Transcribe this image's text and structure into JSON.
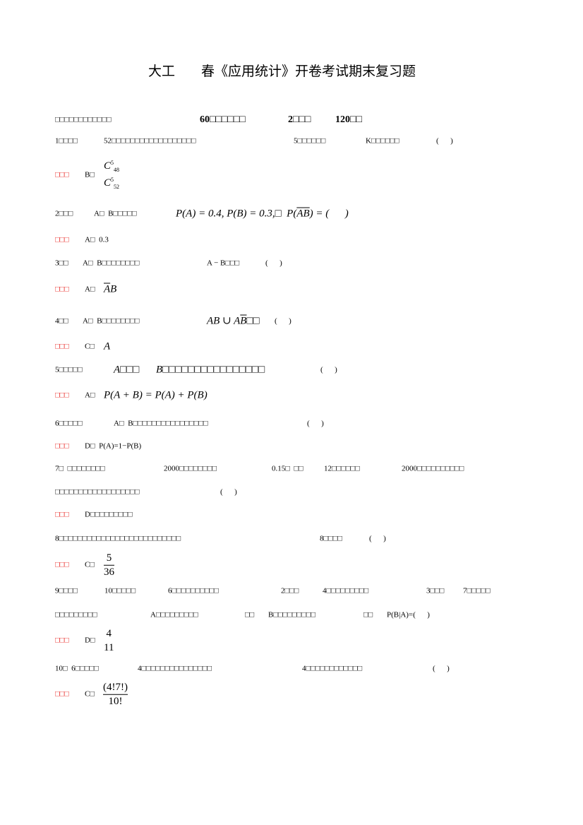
{
  "title": {
    "part1": "大工",
    "part2": "春《应用统计》开卷考试期末复习题"
  },
  "section": {
    "label": "□□□□□□□□□□□□",
    "count": "60□□□□□□",
    "points": "2□□□",
    "total": "120□□"
  },
  "answer_label": "□□□",
  "blank": "(      )",
  "q1": {
    "num": "1□□□□",
    "a": "52□□□□□□□□□□□□□□□□□□",
    "b": "5□□□□□□",
    "c": "K□□□□□□",
    "ans": "B□",
    "frac_num": "C",
    "frac_num_sup": "5",
    "frac_num_sub": "48",
    "frac_den": "C",
    "frac_den_sup": "5",
    "frac_den_sub": "52"
  },
  "q2": {
    "num": "2□□□",
    "a": "A□  B□□□□□",
    "formula": "P(A) = 0.4, P(B) = 0.3,□  P(",
    "formula_bar": "AB",
    "formula_end": ") = (      )",
    "ans": "A□  0.3"
  },
  "q3": {
    "num": "3□□",
    "a": "A□  B□□□□□□□□",
    "b": "A − B□□□",
    "ans": "A□",
    "ans_bar": "A",
    "ans_rest": "B"
  },
  "q4": {
    "num": "4□□",
    "a": "A□  B□□□□□□□□",
    "b1": "AB ∪ A",
    "b_bar": "B",
    "b2": "□□",
    "ans": "C□",
    "ans_math": "A"
  },
  "q5": {
    "num": "5□□□□□",
    "a": "A□□□",
    "b": "B□□□□□□□□□□□□□□□□",
    "ans": "A□",
    "ans_math": "P(A + B) = P(A) + P(B)"
  },
  "q6": {
    "num": "6□□□□□",
    "a": "A□  B□□□□□□□□□□□□□□□□",
    "ans": "D□  P(A)=1−P(B)"
  },
  "q7": {
    "num": "7□  □□□□□□□□",
    "a": "2000□□□□□□□□",
    "b": "0.15□  □□",
    "c": "12□□□□□□",
    "d": "2000□□□□□□□□□□",
    "line2": "□□□□□□□□□□□□□□□□□□",
    "ans": "D□□□□□□□□□"
  },
  "q8": {
    "num": "8□□□□□□□□□□□□□□□□□□□□□□□□□□",
    "a": "8□□□□",
    "ans": "C□",
    "frac_num": "5",
    "frac_den": "36"
  },
  "q9": {
    "num": "9□□□□",
    "a": "10□□□□□",
    "b": "6□□□□□□□□□□",
    "c": "2□□□",
    "d": "4□□□□□□□□□",
    "e": "3□□□",
    "f": "7□□□□□",
    "line2": "□□□□□□□□□",
    "g": "A□□□□□□□□□",
    "h": "□□",
    "i": "B□□□□□□□□□",
    "j": "□□",
    "k": "P(B|A)=(      )",
    "ans": "D□",
    "frac_num": "4",
    "frac_den": "11"
  },
  "q10": {
    "num": "10□  6□□□□□",
    "a": "4□□□□□□□□□□□□□□□",
    "b": "4□□□□□□□□□□□□",
    "ans": "C□",
    "frac_num": "(4!7!)",
    "frac_den": "10!"
  }
}
